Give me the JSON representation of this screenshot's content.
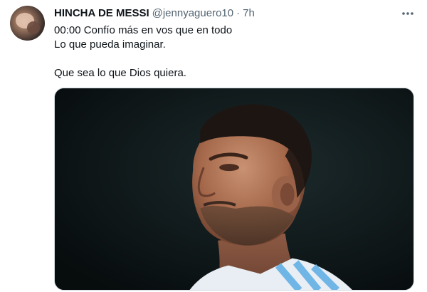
{
  "tweet": {
    "display_name": "HINCHA DE MESSI",
    "handle": "@jennyaguero10",
    "separator": "·",
    "time": "7h",
    "text_lines": [
      "00:00 Confío más en vos que en todo",
      "Lo que pueda imaginar.",
      "",
      "Que sea lo que Dios quiera."
    ]
  },
  "icons": {
    "more": "more-horizontal-icon"
  },
  "colors": {
    "text_primary": "#0f1419",
    "text_secondary": "#536471",
    "media_background": "#0d1618"
  }
}
